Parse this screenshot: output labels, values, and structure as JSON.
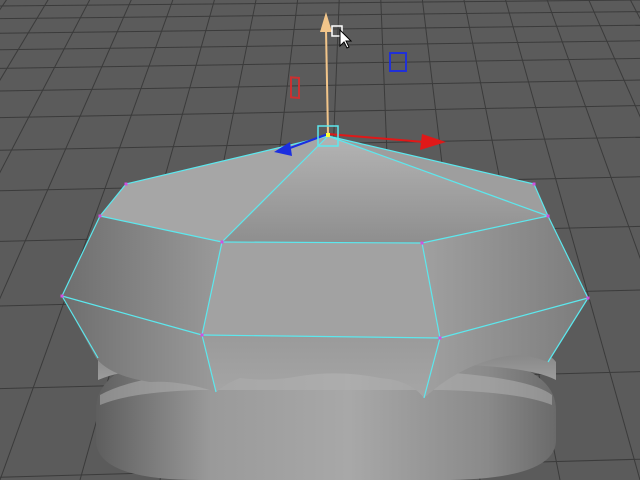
{
  "viewport": {
    "background": "#5b5b5b",
    "grid_color": "#3b3b3b"
  },
  "mesh": {
    "wire_color": "#5ce8ee",
    "vertex_color": "#d24fe0",
    "selected_vertex_color": "#ffff33",
    "face_color": "#8f8f8f"
  },
  "manipulator": {
    "x_axis_color": "#e01818",
    "y_axis_color": "#f2c58a",
    "z_axis_color": "#1b2fe0",
    "center_box_color": "#5ce8ee",
    "xy_plane_color": "#2030d8",
    "yz_plane_color": "#cc3030"
  },
  "cursor": {
    "icon": "arrow-cursor-icon"
  }
}
